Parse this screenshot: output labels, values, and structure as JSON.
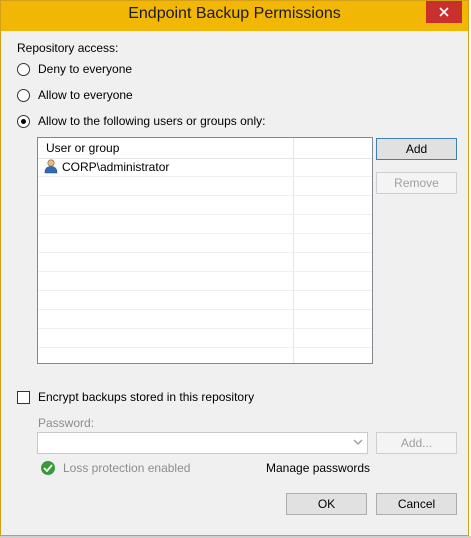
{
  "window": {
    "title": "Endpoint Backup Permissions"
  },
  "repository": {
    "section_label": "Repository access:",
    "options": [
      {
        "label": "Deny to everyone",
        "selected": false
      },
      {
        "label": "Allow to everyone",
        "selected": false
      },
      {
        "label": "Allow to the following users or groups only:",
        "selected": true
      }
    ]
  },
  "list": {
    "column_header": "User or group",
    "items": [
      {
        "name": "CORP\\administrator",
        "icon": "user-icon"
      }
    ]
  },
  "buttons": {
    "add": "Add",
    "remove": "Remove",
    "add_password": "Add...",
    "ok": "OK",
    "cancel": "Cancel"
  },
  "encryption": {
    "checkbox_label": "Encrypt backups stored in this repository",
    "checked": false,
    "password_label": "Password:",
    "password_value": "",
    "loss_protection": "Loss protection enabled",
    "manage_passwords": "Manage passwords"
  },
  "colors": {
    "titlebar": "#f2b705",
    "close": "#c9302c",
    "check": "#3a9a3a"
  }
}
